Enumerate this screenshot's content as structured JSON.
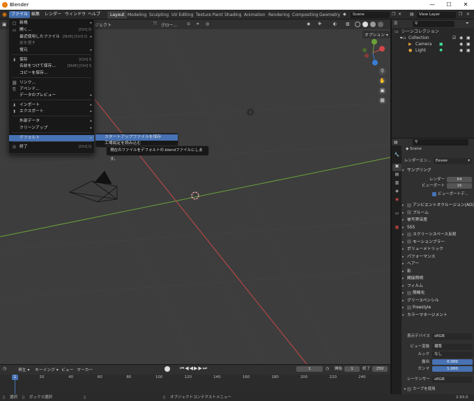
{
  "window": {
    "title": "Blender",
    "minimize": "—",
    "maximize": "☐",
    "close": "✕"
  },
  "menubar": {
    "items": [
      "ファイル",
      "編集",
      "レンダー",
      "ウィンドウ",
      "ヘルプ"
    ]
  },
  "workspace_tabs": [
    "Layout",
    "Modeling",
    "Sculpting",
    "UV Editing",
    "Texture Paint",
    "Shading",
    "Animation",
    "Rendering",
    "Compositing",
    "Geometry"
  ],
  "scene": {
    "name": "Scene",
    "view_layer": "View Layer"
  },
  "viewport_header": {
    "select_label": "グロー...",
    "options_label": "オプション",
    "partial_label": "ジェクト"
  },
  "file_menu": {
    "items": [
      {
        "icon": "new-icon",
        "label": "新規",
        "shortcut": "",
        "submenu": true
      },
      {
        "icon": "open-icon",
        "label": "開く...",
        "shortcut": "[Ctrl] O",
        "submenu": false
      },
      {
        "icon": "",
        "label": "最近使用したファイル",
        "shortcut": "[Shift] [Ctrl] O",
        "submenu": true
      },
      {
        "icon": "",
        "label": "前を復す",
        "shortcut": "",
        "submenu": false
      },
      {
        "icon": "",
        "label": "復元",
        "shortcut": "",
        "submenu": true
      },
      {
        "icon": "save-icon",
        "label": "保存",
        "shortcut": "[Ctrl] S",
        "submenu": false
      },
      {
        "icon": "",
        "label": "名前をつけて保存...",
        "shortcut": "[Shift] [Ctrl] S",
        "submenu": false
      },
      {
        "icon": "",
        "label": "コピーを保存...",
        "shortcut": "",
        "submenu": false
      },
      {
        "icon": "link-icon",
        "label": "リンク...",
        "shortcut": "",
        "submenu": false
      },
      {
        "icon": "append-icon",
        "label": "アペンド...",
        "shortcut": "",
        "submenu": false
      },
      {
        "icon": "",
        "label": "データのプレビュー",
        "shortcut": "",
        "submenu": true
      },
      {
        "icon": "import-icon",
        "label": "インポート",
        "shortcut": "",
        "submenu": true
      },
      {
        "icon": "export-icon",
        "label": "エクスポート",
        "shortcut": "",
        "submenu": true
      },
      {
        "icon": "",
        "label": "外部データ",
        "shortcut": "",
        "submenu": true
      },
      {
        "icon": "",
        "label": "クリーンアップ",
        "shortcut": "",
        "submenu": true
      },
      {
        "icon": "",
        "label": "デフォルト",
        "shortcut": "",
        "submenu": true
      },
      {
        "icon": "quit-icon",
        "label": "終了",
        "shortcut": "[Ctrl] Q",
        "submenu": false
      }
    ]
  },
  "default_submenu": {
    "items": [
      "スタートアップファイルを保存",
      "工場設定を読み込む"
    ]
  },
  "tooltip": "現在のファイルをデフォルトの.blendファイルにします。",
  "outliner": {
    "header": "シーンコレクション",
    "rows": [
      {
        "label": "Collection",
        "level": 1
      },
      {
        "label": "Camera",
        "level": 2
      },
      {
        "label": "Light",
        "level": 2
      }
    ]
  },
  "properties": {
    "scene_name": "Scene",
    "render_engine_label": "レンダーエン...",
    "render_engine_value": "Eevee",
    "sampling": {
      "title": "サンプリング",
      "render_label": "レンダー",
      "render_value": "64",
      "viewport_label": "ビューポート",
      "viewport_value": "16",
      "denoise_label": "ビューポートデ..."
    },
    "panels": [
      "アンビエントオクルージョン(AO)",
      "ブルーム",
      "被写界深度",
      "SSS",
      "スクリーンスペース反射",
      "モーションブラー",
      "ボリューメトリック",
      "パフォーマンス",
      "ヘアー",
      "影",
      "間接照明",
      "フィルム",
      "簡略化",
      "グリースペンシル",
      "Freestyle",
      "カラーマネージメント"
    ],
    "panel_checkbox": [
      true,
      true,
      false,
      false,
      true,
      true,
      false,
      false,
      false,
      false,
      false,
      false,
      true,
      false,
      true,
      false
    ],
    "color": {
      "display_label": "表示デバイス",
      "display_value": "sRGB",
      "view_label": "ビュー変換",
      "view_value": "標準",
      "look_label": "ルック",
      "look_value": "なし",
      "exposure_label": "露出",
      "exposure_value": "0.000",
      "gamma_label": "ガンマ",
      "gamma_value": "1.000",
      "sequencer_label": "シーケンサー",
      "sequencer_value": "sRGB",
      "curve_label": "カーブを使用"
    }
  },
  "timeline": {
    "playback_label": "再生",
    "keying_label": "キーイング",
    "view_label": "ビュー",
    "marker_label": "マーカー",
    "current_frame": "1",
    "start_label": "開始",
    "start_value": "1",
    "end_label": "終了",
    "end_value": "250",
    "ticks": [
      "1",
      "20",
      "40",
      "60",
      "80",
      "100",
      "120",
      "140",
      "160",
      "180",
      "200",
      "220",
      "240"
    ],
    "tick_frames": [
      1,
      20,
      40,
      60,
      80,
      100,
      120,
      140,
      160,
      180,
      200,
      220,
      240
    ]
  },
  "status": {
    "select": "選択",
    "box_select": "ボックス選択",
    "context_menu": "オブジェクトコンテクストメニュー",
    "version": "2.93.0"
  },
  "colors": {
    "accent": "#4772b3",
    "x_axis": "#d14848",
    "y_axis": "#6ba33a"
  }
}
